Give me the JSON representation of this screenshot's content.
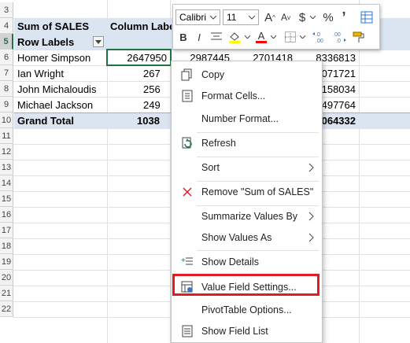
{
  "rows": [
    "3",
    "4",
    "5",
    "6",
    "7",
    "8",
    "9",
    "10",
    "11",
    "12",
    "13",
    "14",
    "15",
    "16",
    "17",
    "18",
    "19",
    "20",
    "21",
    "22"
  ],
  "pivot": {
    "sum_label": "Sum of SALES",
    "col_labels": "Column Labels",
    "row_labels": "Row Labels",
    "records": [
      {
        "name": "Homer Simpson",
        "c1": "2647950",
        "c2": "2987445",
        "c3": "2701418",
        "total": "8336813"
      },
      {
        "name": "Ian Wright",
        "c1": "267",
        "total": "071721"
      },
      {
        "name": "John Michaloudis",
        "c1": "256",
        "total": "158034"
      },
      {
        "name": "Michael Jackson",
        "c1": "249",
        "total": "497764"
      }
    ],
    "grand_total_label": "Grand Total",
    "grand_c1": "1038",
    "grand_total": "064332"
  },
  "toolbar": {
    "font": "Calibri",
    "size": "11",
    "grow_font": "A",
    "shrink_font": "A",
    "currency": "$",
    "percent": "%",
    "comma": "’",
    "bold": "B",
    "italic": "I",
    "font_color_letter": "A",
    "inc_decimal": "←.0\n.00",
    "dec_decimal": ".00→.0",
    "accent": "#217346",
    "highlight_color": "#ffff00",
    "font_color": "#ff0000"
  },
  "menu": {
    "copy": "Copy",
    "format_cells": "Format Cells...",
    "number_format": "Number Format...",
    "refresh": "Refresh",
    "sort": "Sort",
    "remove": "Remove \"Sum of SALES\"",
    "summarize": "Summarize Values By",
    "show_values_as": "Show Values As",
    "show_details": "Show Details",
    "value_field_settings": "Value Field Settings...",
    "pivot_options": "PivotTable Options...",
    "show_field_list": "Show Field List"
  }
}
